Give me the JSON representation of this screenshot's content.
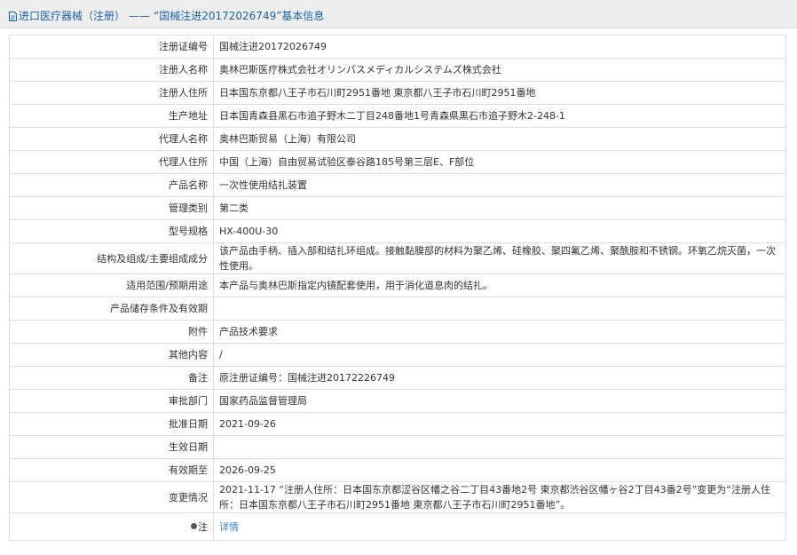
{
  "header": {
    "breadcrumb_category": "进口医疗器械（注册）",
    "separator": "——",
    "record_title": "“国械注进20172026749”基本信息"
  },
  "rows": [
    {
      "label": "注册证编号",
      "value": "国械注进20172026749"
    },
    {
      "label": "注册人名称",
      "value": "奥林巴斯医疗株式会社オリンパスメディカルシステムズ株式会社"
    },
    {
      "label": "注册人住所",
      "value": "日本国东京都八王子市石川町2951番地 東京都八王子市石川町2951番地"
    },
    {
      "label": "生产地址",
      "value": "日本国青森县黑石市追子野木二丁目248番地1号青森県黒石市追子野木2-248-1"
    },
    {
      "label": "代理人名称",
      "value": "奥林巴斯贸易（上海）有限公司"
    },
    {
      "label": "代理人住所",
      "value": "中国（上海）自由贸易试验区泰谷路185号第三层E、F部位"
    },
    {
      "label": "产品名称",
      "value": "一次性使用结扎装置"
    },
    {
      "label": "管理类别",
      "value": "第二类"
    },
    {
      "label": "型号规格",
      "value": "HX-400U-30"
    },
    {
      "label": "结构及组成/主要组成成分",
      "value": "该产品由手柄、插入部和结扎环组成。接触黏膜部的材料为聚乙烯、硅橡胶、聚四氟乙烯、聚酰胺和不锈钢。环氧乙烷灭菌，一次性使用。"
    },
    {
      "label": "适用范围/预期用途",
      "value": "本产品与奥林巴斯指定内镜配套使用，用于消化道息肉的结扎。"
    },
    {
      "label": "产品储存条件及有效期",
      "value": ""
    },
    {
      "label": "附件",
      "value": "产品技术要求"
    },
    {
      "label": "其他内容",
      "value": "/"
    },
    {
      "label": "备注",
      "value": "原注册证编号：国械注进20172226749"
    },
    {
      "label": "审批部门",
      "value": "国家药品监督管理局"
    },
    {
      "label": "批准日期",
      "value": "2021-09-26"
    },
    {
      "label": "生效日期",
      "value": ""
    },
    {
      "label": "有效期至",
      "value": "2026-09-25"
    },
    {
      "label": "变更情况",
      "value": "2021-11-17 “注册人住所：日本国东京都涩谷区幡之谷二丁目43番地2号 東京都渋谷区幡ヶ谷2丁目43番2号”变更为“注册人住所：日本国东京都八王子市石川町2951番地 東京都八王子市石川町2951番地”。"
    }
  ],
  "note_row": {
    "label": "注",
    "link_text": "详情",
    "icon": "pin-icon"
  },
  "colors": {
    "link": "#3a7fc7",
    "title": "#1b62a8",
    "border": "#dedede",
    "header_bg": "#eeeeee"
  }
}
